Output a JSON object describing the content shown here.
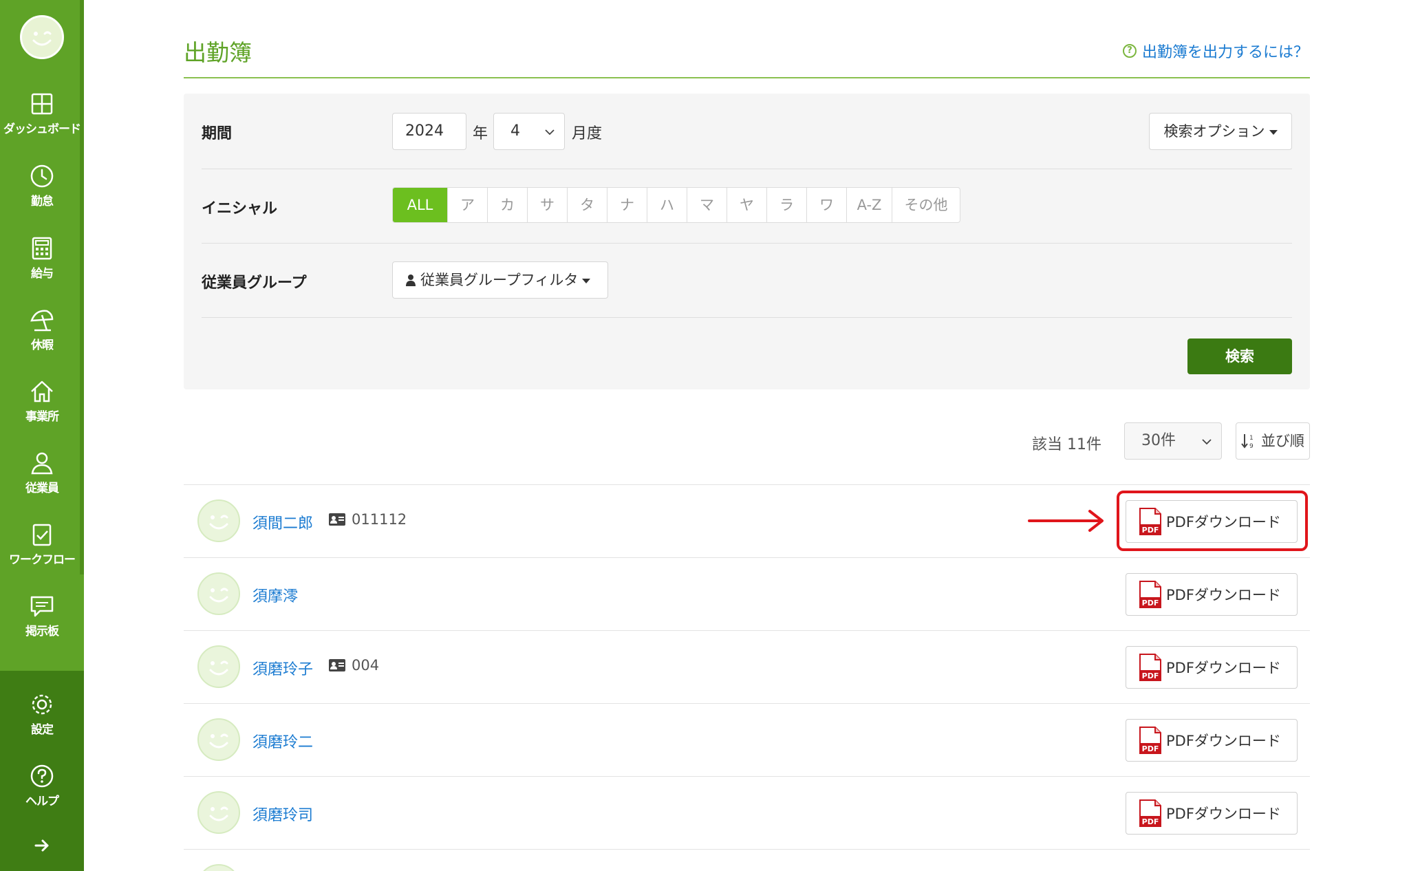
{
  "sidebar": {
    "items": [
      {
        "label": "ダッシュボード",
        "icon": "dashboard-icon"
      },
      {
        "label": "勤怠",
        "icon": "clock-icon"
      },
      {
        "label": "給与",
        "icon": "calculator-icon"
      },
      {
        "label": "休暇",
        "icon": "beach-umbrella-icon"
      },
      {
        "label": "事業所",
        "icon": "home-icon"
      },
      {
        "label": "従業員",
        "icon": "person-icon"
      },
      {
        "label": "ワークフロー",
        "icon": "clipboard-check-icon"
      },
      {
        "label": "掲示板",
        "icon": "chat-icon"
      }
    ],
    "bottom_items": [
      {
        "label": "設定",
        "icon": "gear-icon"
      },
      {
        "label": "ヘルプ",
        "icon": "question-icon"
      }
    ]
  },
  "header": {
    "title": "出勤簿",
    "help_link": "出勤簿を出力するには？"
  },
  "filters": {
    "period_label": "期間",
    "year_value": "2024",
    "year_unit": "年",
    "month_value": "4",
    "month_unit": "月度",
    "search_options": "検索オプション",
    "initial_label": "イニシャル",
    "initials": [
      "ALL",
      "ア",
      "カ",
      "サ",
      "タ",
      "ナ",
      "ハ",
      "マ",
      "ヤ",
      "ラ",
      "ワ",
      "A-Z",
      "その他"
    ],
    "initial_selected": "ALL",
    "group_label": "従業員グループ",
    "group_filter": "従業員グループフィルタ",
    "search_button": "検索"
  },
  "results": {
    "count_text": "該当 11件",
    "per_page": "30件",
    "sort_label": "並び順",
    "download_label": "PDFダウンロード",
    "employees": [
      {
        "name": "須間二郎",
        "id": "011112"
      },
      {
        "name": "須摩澪",
        "id": ""
      },
      {
        "name": "須磨玲子",
        "id": "004"
      },
      {
        "name": "須磨玲二",
        "id": ""
      },
      {
        "name": "須磨玲司",
        "id": ""
      }
    ]
  },
  "colors": {
    "sidebar_green": "#5fa327",
    "title_green": "#5fa327",
    "active_initial": "#6cbf1f",
    "search_button": "#3b7a12",
    "link_blue": "#1b7bd1",
    "highlight_red": "#e0151b"
  }
}
